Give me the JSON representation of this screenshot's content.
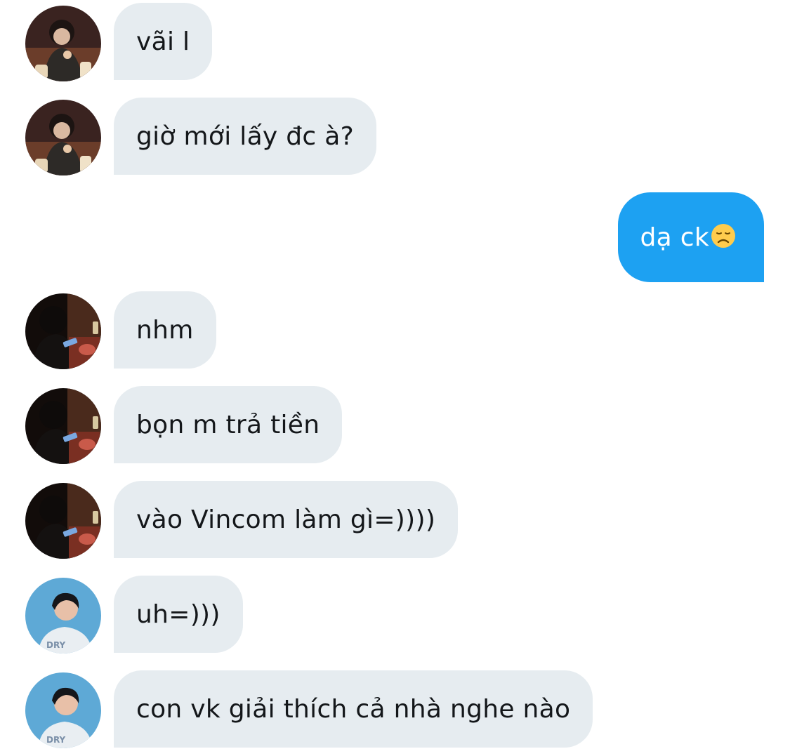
{
  "conversation": {
    "messages": [
      {
        "sender": "friend-a",
        "text": "vãi l"
      },
      {
        "sender": "friend-a",
        "text": "giờ mới lấy đc à?"
      },
      {
        "sender": "me",
        "text": "dạ ck",
        "emoji": "disappointed-face-icon"
      },
      {
        "sender": "friend-b",
        "text": "nhm"
      },
      {
        "sender": "friend-b",
        "text": "bọn m trả tiền"
      },
      {
        "sender": "friend-b",
        "text": "vào Vincom làm gì=))))"
      },
      {
        "sender": "friend-c",
        "text": "uh=)))"
      },
      {
        "sender": "friend-c",
        "text": "con vk giải thích cả nhà nghe nào"
      }
    ]
  },
  "colors": {
    "incoming_bubble": "#e6ecf0",
    "outgoing_bubble": "#1da1f2",
    "incoming_text": "#14171a",
    "outgoing_text": "#ffffff"
  }
}
